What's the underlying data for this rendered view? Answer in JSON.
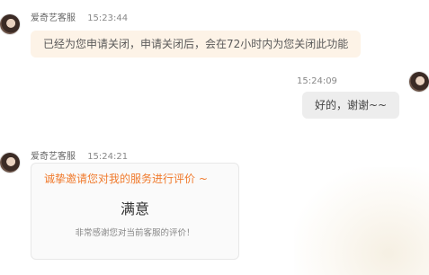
{
  "conversation": {
    "messages": [
      {
        "sender": "爱奇艺客服",
        "time": "15:23:44",
        "text": "已经为您申请关闭，申请关闭后，会在72小时内为您关闭此功能"
      },
      {
        "time": "15:24:09",
        "text": "好的，谢谢~~"
      },
      {
        "sender": "爱奇艺客服",
        "time": "15:24:21",
        "card": {
          "invite": "诚挚邀请您对我的服务进行评价 ~",
          "rating": "满意",
          "thanks": "非常感谢您对当前客服的评价！"
        }
      }
    ]
  },
  "colors": {
    "agent_bubble": "#fdf3e7",
    "user_bubble": "#ededed",
    "accent_orange": "#f07a2c"
  }
}
